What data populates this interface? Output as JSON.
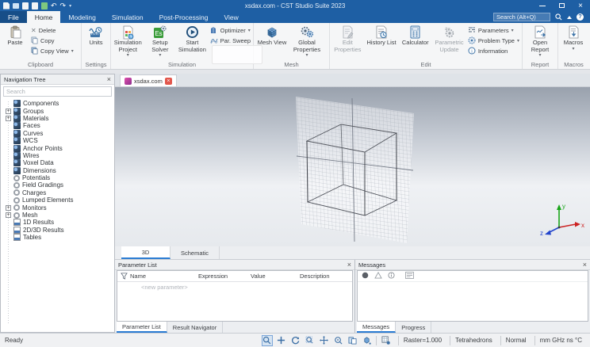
{
  "titlebar": {
    "title": "xsdax.com - CST Studio Suite 2023"
  },
  "tabs": {
    "file": "File",
    "items": [
      "Home",
      "Modeling",
      "Simulation",
      "Post-Processing",
      "View"
    ],
    "search_placeholder": "Search (Alt+Q)"
  },
  "ribbon": {
    "clipboard": {
      "label": "Clipboard",
      "paste": "Paste",
      "delete": "Delete",
      "copy": "Copy",
      "copy_view": "Copy View"
    },
    "settings": {
      "label": "Settings",
      "units": "Units"
    },
    "simulation": {
      "label": "Simulation",
      "simulation_project": "Simulation Project",
      "setup_solver": "Setup Solver",
      "start_simulation": "Start Simulation",
      "optimizer": "Optimizer",
      "par_sweep": "Par. Sweep"
    },
    "mesh": {
      "label": "Mesh",
      "mesh_view": "Mesh View",
      "global_properties": "Global Properties"
    },
    "edit": {
      "label": "Edit",
      "edit_properties": "Edit Properties",
      "history_list": "History List",
      "calculator": "Calculator",
      "parametric_update": "Parametric Update",
      "parameters": "Parameters",
      "problem_type": "Problem Type",
      "information": "Information"
    },
    "report": {
      "label": "Report",
      "open_report": "Open Report"
    },
    "macros": {
      "label": "Macros",
      "macros": "Macros"
    }
  },
  "nav_tree": {
    "title": "Navigation Tree",
    "search_placeholder": "Search",
    "items": [
      {
        "label": "Components",
        "icon": "cube",
        "expander": false
      },
      {
        "label": "Groups",
        "icon": "cube",
        "expander": true
      },
      {
        "label": "Materials",
        "icon": "cube",
        "expander": true
      },
      {
        "label": "Faces",
        "icon": "cube",
        "expander": false
      },
      {
        "label": "Curves",
        "icon": "cube",
        "expander": false
      },
      {
        "label": "WCS",
        "icon": "cube",
        "expander": false
      },
      {
        "label": "Anchor Points",
        "icon": "cube",
        "expander": false
      },
      {
        "label": "Wires",
        "icon": "cube",
        "expander": false
      },
      {
        "label": "Voxel Data",
        "icon": "cube",
        "expander": false
      },
      {
        "label": "Dimensions",
        "icon": "cube",
        "expander": false
      },
      {
        "label": "Potentials",
        "icon": "circle",
        "expander": false
      },
      {
        "label": "Field Gradings",
        "icon": "circle",
        "expander": false
      },
      {
        "label": "Charges",
        "icon": "circle",
        "expander": false
      },
      {
        "label": "Lumped Elements",
        "icon": "circle",
        "expander": false
      },
      {
        "label": "Monitors",
        "icon": "circle",
        "expander": true
      },
      {
        "label": "Mesh",
        "icon": "circle",
        "expander": true
      },
      {
        "label": "1D Results",
        "icon": "chart",
        "expander": false
      },
      {
        "label": "2D/3D Results",
        "icon": "chart",
        "expander": false
      },
      {
        "label": "Tables",
        "icon": "chart",
        "expander": false
      }
    ]
  },
  "document": {
    "tab_label": "xsdax.com"
  },
  "view_tabs": {
    "three_d": "3D",
    "schematic": "Schematic"
  },
  "axes": {
    "x": "x",
    "y": "y",
    "z": "z"
  },
  "parameter_list": {
    "title": "Parameter List",
    "columns": [
      "Name",
      "Expression",
      "Value",
      "Description"
    ],
    "placeholder_row": "<new parameter>",
    "tab_parameter_list": "Parameter List",
    "tab_result_navigator": "Result Navigator"
  },
  "messages": {
    "title": "Messages",
    "tab_messages": "Messages",
    "tab_progress": "Progress"
  },
  "statusbar": {
    "ready": "Ready",
    "raster": "Raster=1.000",
    "mesh_type": "Tetrahedrons",
    "view_mode": "Normal",
    "units": "mm GHz ns °C"
  },
  "colors": {
    "titlebar": "#1e5fa4",
    "accent": "#2b7cd3"
  }
}
